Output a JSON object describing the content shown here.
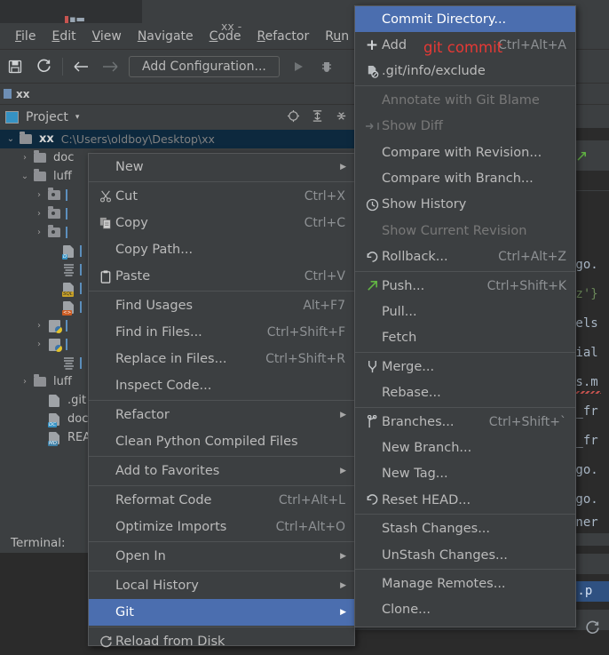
{
  "window": {
    "title_fragment": "xx",
    "editor_tab_title": "xx - "
  },
  "menubar": {
    "items": [
      {
        "label": "File",
        "accel": "F"
      },
      {
        "label": "Edit",
        "accel": "E"
      },
      {
        "label": "View",
        "accel": "V"
      },
      {
        "label": "Navigate",
        "accel": "N"
      },
      {
        "label": "Code",
        "accel": "C"
      },
      {
        "label": "Refactor",
        "accel": "R"
      },
      {
        "label": "Run",
        "accel": "u"
      }
    ]
  },
  "toolbar": {
    "save_icon": "save-icon",
    "sync_icon": "refresh-icon",
    "back_icon": "arrow-left-icon",
    "forward_icon": "arrow-right-icon",
    "run_configuration": "Add Configuration...",
    "run_icon": "run-play-icon",
    "debug_icon": "debug-icon"
  },
  "navbar": {
    "crumb": "xx"
  },
  "toolwindow": {
    "title": "Project",
    "caret": "▾",
    "actions": [
      "locate-icon",
      "expand-all-icon",
      "collapse-all-icon"
    ]
  },
  "project_tree": [
    {
      "indent": 0,
      "arrow": "v",
      "icon": "folder",
      "name": "xx",
      "path": "C:\\Users\\oldboy\\Desktop\\xx",
      "selected": true
    },
    {
      "indent": 1,
      "arrow": ">",
      "icon": "folder",
      "name": "doc",
      "path": "",
      "selected": false
    },
    {
      "indent": 1,
      "arrow": "v",
      "icon": "folder",
      "name": "luff",
      "path": "",
      "selected": false
    },
    {
      "indent": 2,
      "arrow": ">",
      "icon": "folder-mod",
      "name": "",
      "path": "",
      "selected": false
    },
    {
      "indent": 2,
      "arrow": ">",
      "icon": "folder-mod",
      "name": "",
      "path": "",
      "selected": false
    },
    {
      "indent": 2,
      "arrow": ">",
      "icon": "folder-mod",
      "name": "",
      "path": "",
      "selected": false
    },
    {
      "indent": 3,
      "arrow": "",
      "icon": "file-d",
      "name": "",
      "path": "",
      "selected": false
    },
    {
      "indent": 3,
      "arrow": "",
      "icon": "file-text",
      "name": "",
      "path": "",
      "selected": false
    },
    {
      "indent": 3,
      "arrow": "",
      "icon": "file-sql",
      "name": "",
      "path": "",
      "selected": false
    },
    {
      "indent": 3,
      "arrow": "",
      "icon": "file-html",
      "name": "",
      "path": "",
      "selected": false
    },
    {
      "indent": 2,
      "arrow": ">",
      "icon": "file-py",
      "name": "",
      "path": "",
      "selected": false
    },
    {
      "indent": 2,
      "arrow": ">",
      "icon": "file-py",
      "name": "",
      "path": "",
      "selected": false
    },
    {
      "indent": 3,
      "arrow": "",
      "icon": "file-text",
      "name": "",
      "path": "",
      "selected": false
    },
    {
      "indent": 1,
      "arrow": ">",
      "icon": "folder",
      "name": "luff",
      "path": "",
      "selected": false
    },
    {
      "indent": 2,
      "arrow": "",
      "icon": "file-ignore",
      "name": ".git",
      "path": "",
      "selected": false
    },
    {
      "indent": 2,
      "arrow": "",
      "icon": "file-dc",
      "name": "doc",
      "path": "",
      "selected": false
    },
    {
      "indent": 2,
      "arrow": "",
      "icon": "file-md",
      "name": "REA",
      "path": "",
      "selected": false
    }
  ],
  "terminal": {
    "label": "Terminal:"
  },
  "editor_code_lines": [
    {
      "text": "ngo.",
      "class": "c-txt"
    },
    {
      "text": "qz'}",
      "class": "c-grn"
    },
    {
      "text": "dels",
      "class": "c-txt"
    },
    {
      "text": "rial",
      "class": "c-txt"
    },
    {
      "text": "ls.m",
      "class": "c-txt"
    },
    {
      "text": "t_fr",
      "class": "c-txt"
    },
    {
      "text": "t_fr",
      "class": "c-txt"
    },
    {
      "text": "ngo.",
      "class": "c-txt"
    },
    {
      "text": "ngo.",
      "class": "c-txt"
    },
    {
      "text": "nner",
      "class": "c-txt"
    },
    {
      "text": "s.p",
      "class": "c-txt"
    }
  ],
  "context_menu": {
    "items": [
      {
        "label": "New",
        "accel": "",
        "shortcut": "",
        "icon": "",
        "submenu": true,
        "separator_after": true,
        "disabled": false,
        "selected": false
      },
      {
        "label": "Cut",
        "accel": "t",
        "shortcut": "Ctrl+X",
        "icon": "scissors-icon",
        "submenu": false,
        "separator_after": false,
        "disabled": false,
        "selected": false
      },
      {
        "label": "Copy",
        "accel": "C",
        "shortcut": "Ctrl+C",
        "icon": "copy-icon",
        "submenu": false,
        "separator_after": false,
        "disabled": false,
        "selected": false
      },
      {
        "label": "Copy Path...",
        "accel": "",
        "shortcut": "",
        "icon": "",
        "submenu": false,
        "separator_after": false,
        "disabled": false,
        "selected": false
      },
      {
        "label": "Paste",
        "accel": "P",
        "shortcut": "Ctrl+V",
        "icon": "clipboard-icon",
        "submenu": false,
        "separator_after": true,
        "disabled": false,
        "selected": false
      },
      {
        "label": "Find Usages",
        "accel": "U",
        "shortcut": "Alt+F7",
        "icon": "",
        "submenu": false,
        "separator_after": false,
        "disabled": false,
        "selected": false
      },
      {
        "label": "Find in Files...",
        "accel": "",
        "shortcut": "Ctrl+Shift+F",
        "icon": "",
        "submenu": false,
        "separator_after": false,
        "disabled": false,
        "selected": false
      },
      {
        "label": "Replace in Files...",
        "accel": "a",
        "shortcut": "Ctrl+Shift+R",
        "icon": "",
        "submenu": false,
        "separator_after": false,
        "disabled": false,
        "selected": false
      },
      {
        "label": "Inspect Code...",
        "accel": "I",
        "shortcut": "",
        "icon": "",
        "submenu": false,
        "separator_after": true,
        "disabled": false,
        "selected": false
      },
      {
        "label": "Refactor",
        "accel": "R",
        "shortcut": "",
        "icon": "",
        "submenu": true,
        "separator_after": false,
        "disabled": false,
        "selected": false
      },
      {
        "label": "Clean Python Compiled Files",
        "accel": "",
        "shortcut": "",
        "icon": "",
        "submenu": false,
        "separator_after": true,
        "disabled": false,
        "selected": false
      },
      {
        "label": "Add to Favorites",
        "accel": "a",
        "shortcut": "",
        "icon": "",
        "submenu": true,
        "separator_after": true,
        "disabled": false,
        "selected": false
      },
      {
        "label": "Reformat Code",
        "accel": "R",
        "shortcut": "Ctrl+Alt+L",
        "icon": "",
        "submenu": false,
        "separator_after": false,
        "disabled": false,
        "selected": false
      },
      {
        "label": "Optimize Imports",
        "accel": "z",
        "shortcut": "Ctrl+Alt+O",
        "icon": "",
        "submenu": false,
        "separator_after": true,
        "disabled": false,
        "selected": false
      },
      {
        "label": "Open In",
        "accel": "",
        "shortcut": "",
        "icon": "",
        "submenu": true,
        "separator_after": true,
        "disabled": false,
        "selected": false
      },
      {
        "label": "Local History",
        "accel": "H",
        "shortcut": "",
        "icon": "",
        "submenu": true,
        "separator_after": false,
        "disabled": false,
        "selected": false
      },
      {
        "label": "Git",
        "accel": "G",
        "shortcut": "",
        "icon": "",
        "submenu": true,
        "separator_after": true,
        "disabled": false,
        "selected": true
      },
      {
        "label": "Reload from Disk",
        "accel": "",
        "shortcut": "",
        "icon": "refresh-icon",
        "submenu": false,
        "separator_after": false,
        "disabled": false,
        "selected": false
      }
    ]
  },
  "git_submenu": {
    "items": [
      {
        "label": "Commit Directory...",
        "accel": "t",
        "shortcut": "",
        "icon": "",
        "submenu": false,
        "separator_after": false,
        "disabled": false,
        "selected": true
      },
      {
        "label": "Add",
        "accel": "",
        "shortcut": "Ctrl+Alt+A",
        "icon": "plus-icon",
        "submenu": false,
        "separator_after": false,
        "disabled": false,
        "selected": false
      },
      {
        "label": ".git/info/exclude",
        "accel": "",
        "shortcut": "",
        "icon": "file-exclude-icon",
        "submenu": false,
        "separator_after": true,
        "disabled": false,
        "selected": false
      },
      {
        "label": "Annotate with Git Blame",
        "accel": "n",
        "shortcut": "",
        "icon": "",
        "submenu": false,
        "separator_after": false,
        "disabled": true,
        "selected": false
      },
      {
        "label": "Show Diff",
        "accel": "",
        "shortcut": "",
        "icon": "diff-icon",
        "submenu": false,
        "separator_after": false,
        "disabled": true,
        "selected": false
      },
      {
        "label": "Compare with Revision...",
        "accel": "C",
        "shortcut": "",
        "icon": "",
        "submenu": false,
        "separator_after": false,
        "disabled": false,
        "selected": false
      },
      {
        "label": "Compare with Branch...",
        "accel": "",
        "shortcut": "",
        "icon": "",
        "submenu": false,
        "separator_after": false,
        "disabled": false,
        "selected": false
      },
      {
        "label": "Show History",
        "accel": "H",
        "shortcut": "",
        "icon": "clock-icon",
        "submenu": false,
        "separator_after": false,
        "disabled": false,
        "selected": false
      },
      {
        "label": "Show Current Revision",
        "accel": "",
        "shortcut": "",
        "icon": "",
        "submenu": false,
        "separator_after": false,
        "disabled": true,
        "selected": false
      },
      {
        "label": "Rollback...",
        "accel": "R",
        "shortcut": "Ctrl+Alt+Z",
        "icon": "rollback-icon",
        "submenu": false,
        "separator_after": true,
        "disabled": false,
        "selected": false
      },
      {
        "label": "Push...",
        "accel": "",
        "shortcut": "Ctrl+Shift+K",
        "icon": "push-arrow-icon",
        "submenu": false,
        "separator_after": false,
        "disabled": false,
        "selected": false
      },
      {
        "label": "Pull...",
        "accel": "",
        "shortcut": "",
        "icon": "",
        "submenu": false,
        "separator_after": false,
        "disabled": false,
        "selected": false
      },
      {
        "label": "Fetch",
        "accel": "",
        "shortcut": "",
        "icon": "",
        "submenu": false,
        "separator_after": true,
        "disabled": false,
        "selected": false
      },
      {
        "label": "Merge...",
        "accel": "",
        "shortcut": "",
        "icon": "merge-icon",
        "submenu": false,
        "separator_after": false,
        "disabled": false,
        "selected": false
      },
      {
        "label": "Rebase...",
        "accel": "",
        "shortcut": "",
        "icon": "",
        "submenu": false,
        "separator_after": true,
        "disabled": false,
        "selected": false
      },
      {
        "label": "Branches...",
        "accel": "B",
        "shortcut": "Ctrl+Shift+`",
        "icon": "branch-icon",
        "submenu": false,
        "separator_after": false,
        "disabled": false,
        "selected": false
      },
      {
        "label": "New Branch...",
        "accel": "",
        "shortcut": "",
        "icon": "",
        "submenu": false,
        "separator_after": false,
        "disabled": false,
        "selected": false
      },
      {
        "label": "New Tag...",
        "accel": "",
        "shortcut": "",
        "icon": "",
        "submenu": false,
        "separator_after": false,
        "disabled": false,
        "selected": false
      },
      {
        "label": "Reset HEAD...",
        "accel": "",
        "shortcut": "",
        "icon": "rollback-icon",
        "submenu": false,
        "separator_after": true,
        "disabled": false,
        "selected": false
      },
      {
        "label": "Stash Changes...",
        "accel": "",
        "shortcut": "",
        "icon": "",
        "submenu": false,
        "separator_after": false,
        "disabled": false,
        "selected": false
      },
      {
        "label": "UnStash Changes...",
        "accel": "",
        "shortcut": "",
        "icon": "",
        "submenu": false,
        "separator_after": true,
        "disabled": false,
        "selected": false
      },
      {
        "label": "Manage Remotes...",
        "accel": "",
        "shortcut": "",
        "icon": "",
        "submenu": false,
        "separator_after": false,
        "disabled": false,
        "selected": false
      },
      {
        "label": "Clone...",
        "accel": "",
        "shortcut": "",
        "icon": "",
        "submenu": false,
        "separator_after": false,
        "disabled": false,
        "selected": false
      }
    ]
  },
  "annotation": {
    "text": "git commit",
    "color": "#e53935"
  },
  "colors": {
    "menu_bg": "#3c3f41",
    "selection_blue": "#4b6eaf",
    "tree_selection": "#0d293e",
    "editor_bg": "#2b2b2b",
    "text": "#bbbbbb",
    "disabled_text": "#787878",
    "shortcut_text": "#8e9194",
    "accent_green": "#62b543",
    "annotation_red": "#e53935"
  }
}
